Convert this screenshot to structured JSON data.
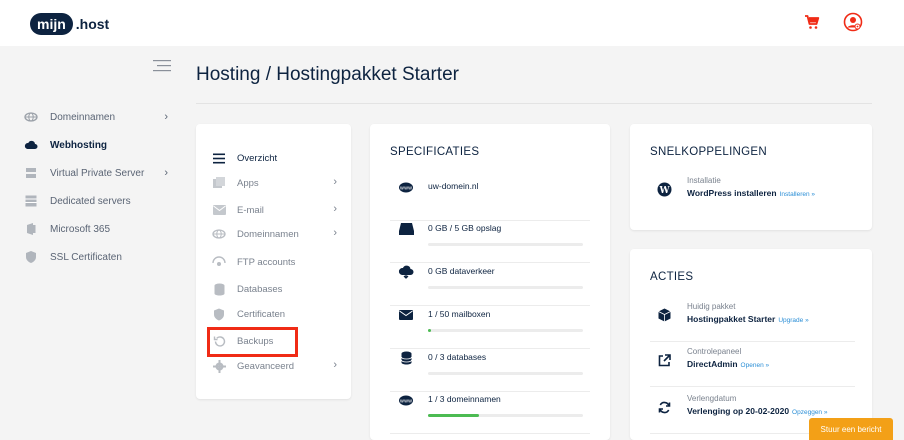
{
  "header": {
    "logo_part1": "mijn",
    "logo_part2": ".host",
    "cart_icon": "cart-icon",
    "user_icon": "user-icon",
    "accent": "#f02b16"
  },
  "sidebar": {
    "items": [
      {
        "label": "Domeinnamen",
        "icon": "globe-icon",
        "chevron": true,
        "active": false
      },
      {
        "label": "Webhosting",
        "icon": "cloud-icon",
        "chevron": false,
        "active": true
      },
      {
        "label": "Virtual Private Server",
        "icon": "server-icon",
        "chevron": true,
        "active": false
      },
      {
        "label": "Dedicated servers",
        "icon": "rack-icon",
        "chevron": false,
        "active": false
      },
      {
        "label": "Microsoft 365",
        "icon": "office-icon",
        "chevron": false,
        "active": false
      },
      {
        "label": "SSL Certificaten",
        "icon": "shield-icon",
        "chevron": false,
        "active": false
      }
    ]
  },
  "page": {
    "title": "Hosting / Hostingpakket Starter"
  },
  "menu": {
    "items": [
      {
        "label": "Overzicht",
        "icon": "list-icon",
        "active": true,
        "chevron": false
      },
      {
        "label": "Apps",
        "icon": "apps-icon",
        "active": false,
        "chevron": true
      },
      {
        "label": "E-mail",
        "icon": "mail-icon",
        "active": false,
        "chevron": true
      },
      {
        "label": "Domeinnamen",
        "icon": "globe-icon",
        "active": false,
        "chevron": true
      },
      {
        "label": "FTP accounts",
        "icon": "ftp-icon",
        "active": false,
        "chevron": false
      },
      {
        "label": "Databases",
        "icon": "database-icon",
        "active": false,
        "chevron": false
      },
      {
        "label": "Certificaten",
        "icon": "shield-icon",
        "active": false,
        "chevron": false
      },
      {
        "label": "Backups",
        "icon": "history-icon",
        "active": false,
        "chevron": false
      },
      {
        "label": "Geavanceerd",
        "icon": "gear-icon",
        "active": false,
        "chevron": true
      }
    ]
  },
  "specificaties": {
    "title": "SPECIFICATIES",
    "rows": [
      {
        "label": "uw-domein.nl",
        "icon": "www-icon",
        "progress": null
      },
      {
        "label": "0 GB / 5 GB opslag",
        "icon": "drive-icon",
        "progress": 0
      },
      {
        "label": "0 GB dataverkeer",
        "icon": "cloud-transfer-icon",
        "progress": 0
      },
      {
        "label": "1 / 50 mailboxen",
        "icon": "mail-icon",
        "progress": 0.02
      },
      {
        "label": "0 / 3 databases",
        "icon": "database-icon",
        "progress": 0
      },
      {
        "label": "1 / 3 domeinnamen",
        "icon": "www-icon",
        "progress": 0.33
      }
    ]
  },
  "snelkoppelingen": {
    "title": "SNELKOPPELINGEN",
    "items": [
      {
        "small": "Installatie",
        "main": "WordPress installeren",
        "link": "Installeren »",
        "icon": "wordpress-icon"
      }
    ]
  },
  "acties": {
    "title": "ACTIES",
    "items": [
      {
        "small": "Huidig pakket",
        "main": "Hostingpakket Starter",
        "link": "Upgrade »",
        "icon": "package-icon"
      },
      {
        "small": "Controlepaneel",
        "main": "DirectAdmin",
        "link": "Openen »",
        "icon": "external-link-icon"
      },
      {
        "small": "Verlengdatum",
        "main": "Verlenging op 20-02-2020",
        "link": "Opzeggen »",
        "icon": "refresh-icon"
      }
    ]
  },
  "chat": {
    "label": "Stuur een bericht"
  }
}
